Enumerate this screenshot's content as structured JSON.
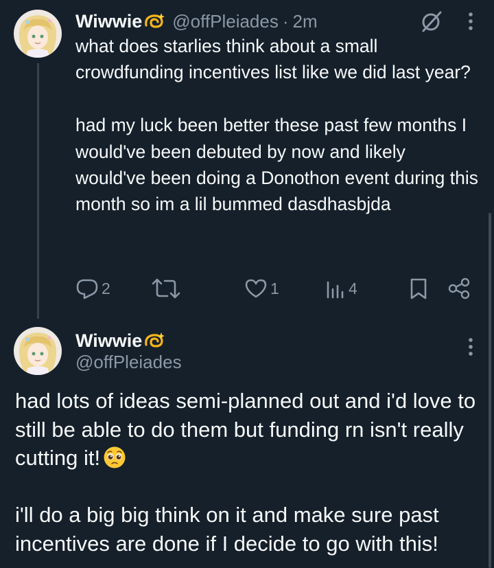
{
  "tweet1": {
    "author_name": "Wiwwie",
    "author_handle": "@offPleiades",
    "separator": "·",
    "time": "2m",
    "text_paragraphs": [
      "what does starlies think about a small crowdfunding incentives list like we did last year?",
      "had my luck been better these past few months I would've been debuted by now and likely would've been doing a Donothon event during this month so im a lil bummed dasdhasbjda"
    ],
    "actions": {
      "reply_count": "2",
      "retweet_count": "",
      "like_count": "1",
      "views_count": "4"
    },
    "icons": [
      "dizzy-emoji",
      "grok-icon",
      "more-icon",
      "reply-icon",
      "retweet-icon",
      "like-icon",
      "views-icon",
      "bookmark-icon",
      "share-icon"
    ]
  },
  "tweet2": {
    "author_name": "Wiwwie",
    "author_handle": "@offPleiades",
    "text_paragraphs": [
      "had lots of ideas semi-planned out and i'd love to still be able to do them but funding rn isn't really cutting it!",
      "i'll do a big big think on it and make sure past incentives are done if I decide to go with this!"
    ],
    "emoji": "pleading-face"
  },
  "colors": {
    "background": "#15202b",
    "text_primary": "#f7f9f9",
    "text_secondary": "#8b98a5",
    "thread_line": "#38444d"
  }
}
